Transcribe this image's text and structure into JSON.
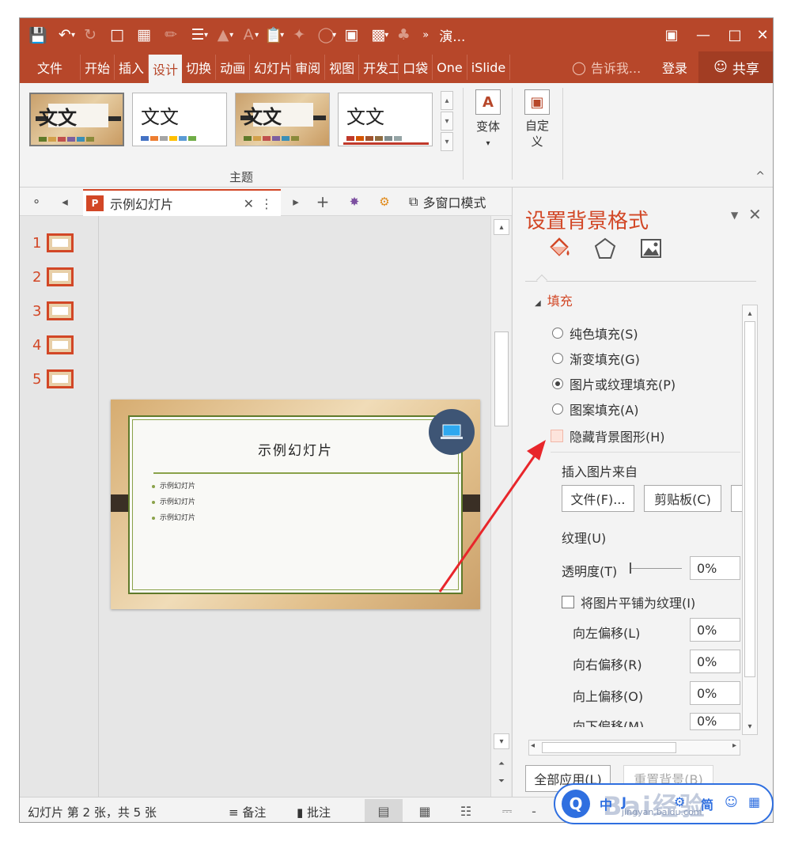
{
  "titlebar": {
    "doc_title": "演...",
    "quick_access": [
      "save-icon",
      "undo-icon",
      "redo-icon",
      "new-icon",
      "layout-icon",
      "eyedropper-icon",
      "format-painter-icon",
      "fill-icon",
      "font-color-icon",
      "clipboard-icon",
      "brush-icon",
      "shape-icon",
      "target-icon",
      "colors-icon",
      "pin-icon",
      "more-icon"
    ],
    "controls": [
      "ribbon-display-icon",
      "minimize-icon",
      "maximize-icon",
      "close-icon"
    ]
  },
  "tabs": [
    "文件",
    "开始",
    "插入",
    "设计",
    "切换",
    "动画",
    "幻灯片",
    "审阅",
    "视图",
    "开发工",
    "口袋",
    "One",
    "iSlide"
  ],
  "active_tab": "设计",
  "tell_me": "告诉我...",
  "login": "登录",
  "share": "共享",
  "ribbon": {
    "themes": [
      {
        "text": "文文",
        "style": "wood"
      },
      {
        "text": "文文",
        "style": "plain"
      },
      {
        "text": "文文",
        "style": "wood"
      },
      {
        "text": "文文",
        "style": "plain-red"
      }
    ],
    "themes_group_label": "主题",
    "variants_label": "变体",
    "customize_label": "自定义"
  },
  "doc_tabs": {
    "file_label": "示例幻灯片",
    "multi_window": "多窗口模式"
  },
  "slides": {
    "numbers": [
      "1",
      "2",
      "3",
      "4",
      "5"
    ],
    "current_title": "示例幻灯片",
    "bullets": [
      "示例幻灯片",
      "示例幻灯片",
      "示例幻灯片"
    ]
  },
  "format_pane": {
    "title": "设置背景格式",
    "fill_header": "填充",
    "options": [
      "纯色填充(S)",
      "渐变填充(G)",
      "图片或纹理填充(P)",
      "图案填充(A)"
    ],
    "selected_option": "图片或纹理填充(P)",
    "hide_bg": "隐藏背景图形(H)",
    "insert_from": "插入图片来自",
    "file_btn": "文件(F)...",
    "clipboard_btn": "剪贴板(C)",
    "texture": "纹理(U)",
    "transparency": "透明度(T)",
    "transparency_value": "0%",
    "tile": "将图片平铺为纹理(I)",
    "offsets": [
      {
        "label": "向左偏移(L)",
        "value": "0%"
      },
      {
        "label": "向右偏移(R)",
        "value": "0%"
      },
      {
        "label": "向上偏移(O)",
        "value": "0%"
      },
      {
        "label": "向下偏移(M)",
        "value": "0%"
      }
    ],
    "apply_all": "全部应用(L)",
    "reset_bg": "重置背景(B)"
  },
  "statusbar": {
    "slide_info": "幻灯片 第 2 张，共 5 张",
    "notes": "备注",
    "comments": "批注"
  },
  "watermark": {
    "brand": "Bai经验",
    "domain": "jingyan.baidu.com",
    "icons": [
      "中",
      "J",
      "🔧",
      "简",
      "☺",
      "⊞"
    ]
  },
  "colors": {
    "accent": "#b7472a",
    "accent_text": "#d24726",
    "arrow": "#e8262b"
  }
}
